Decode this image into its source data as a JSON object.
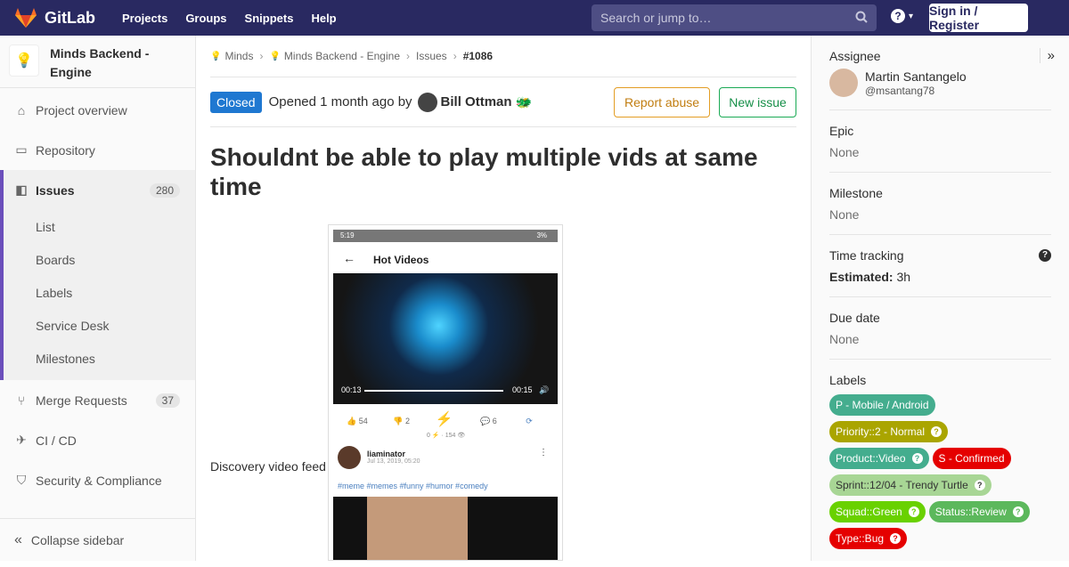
{
  "topbar": {
    "brand": "GitLab",
    "nav": [
      "Projects",
      "Groups",
      "Snippets",
      "Help"
    ],
    "search_placeholder": "Search or jump to…",
    "signin": "Sign in / Register"
  },
  "sidebar": {
    "project_name": "Minds Backend - Engine",
    "items": [
      {
        "label": "Project overview",
        "icon": "home-icon"
      },
      {
        "label": "Repository",
        "icon": "doc-icon"
      },
      {
        "label": "Issues",
        "icon": "issues-icon",
        "badge": "280"
      },
      {
        "label": "Merge Requests",
        "icon": "merge-icon",
        "badge": "37"
      },
      {
        "label": "CI / CD",
        "icon": "rocket-icon"
      },
      {
        "label": "Security & Compliance",
        "icon": "shield-icon"
      }
    ],
    "issue_sub": [
      "List",
      "Boards",
      "Labels",
      "Service Desk",
      "Milestones"
    ],
    "collapse": "Collapse sidebar"
  },
  "breadcrumb": [
    "Minds",
    "Minds Backend - Engine",
    "Issues",
    "#1086"
  ],
  "issue": {
    "status": "Closed",
    "opened_prefix": "Opened 1 month ago by",
    "author": "Bill Ottman",
    "report_label": "Report abuse",
    "new_label": "New issue",
    "title": "Shouldnt be able to play multiple vids at same time",
    "description": "Discovery video feed"
  },
  "phone": {
    "time": "5:19",
    "battery": "3%",
    "header": "Hot Videos",
    "elapsed": "00:13",
    "total": "00:15",
    "up": "54",
    "down": "2",
    "comments": "6",
    "views": "0 ⚡ · 154 👁",
    "username": "liaminator",
    "date": "Jul 13, 2019, 05:20",
    "tags": "#meme #memes #funny #humor #comedy"
  },
  "right": {
    "assignee_hd": "Assignee",
    "assignee_name": "Martin Santangelo",
    "assignee_user": "@msantang78",
    "epic_hd": "Epic",
    "epic_val": "None",
    "milestone_hd": "Milestone",
    "milestone_val": "None",
    "time_hd": "Time tracking",
    "estimated_label": "Estimated:",
    "estimated_val": "3h",
    "due_hd": "Due date",
    "due_val": "None",
    "labels_hd": "Labels",
    "labels": [
      {
        "text": "P - Mobile / Android",
        "color": "#44ad8e",
        "q": false
      },
      {
        "text": "Priority::2 - Normal",
        "color": "#aaa500",
        "q": true
      },
      {
        "text": "Product::Video",
        "color": "#44ad8e",
        "q": true
      },
      {
        "text": "S - Confirmed",
        "color": "#e50000",
        "q": false
      },
      {
        "text": "Sprint::12/04 - Trendy Turtle",
        "color": "#a8d695",
        "dark": true,
        "q": true
      },
      {
        "text": "Squad::Green",
        "color": "#69d100",
        "q": true
      },
      {
        "text": "Status::Review",
        "color": "#5cb85c",
        "q": true
      },
      {
        "text": "Type::Bug",
        "color": "#e50000",
        "q": true
      }
    ]
  }
}
